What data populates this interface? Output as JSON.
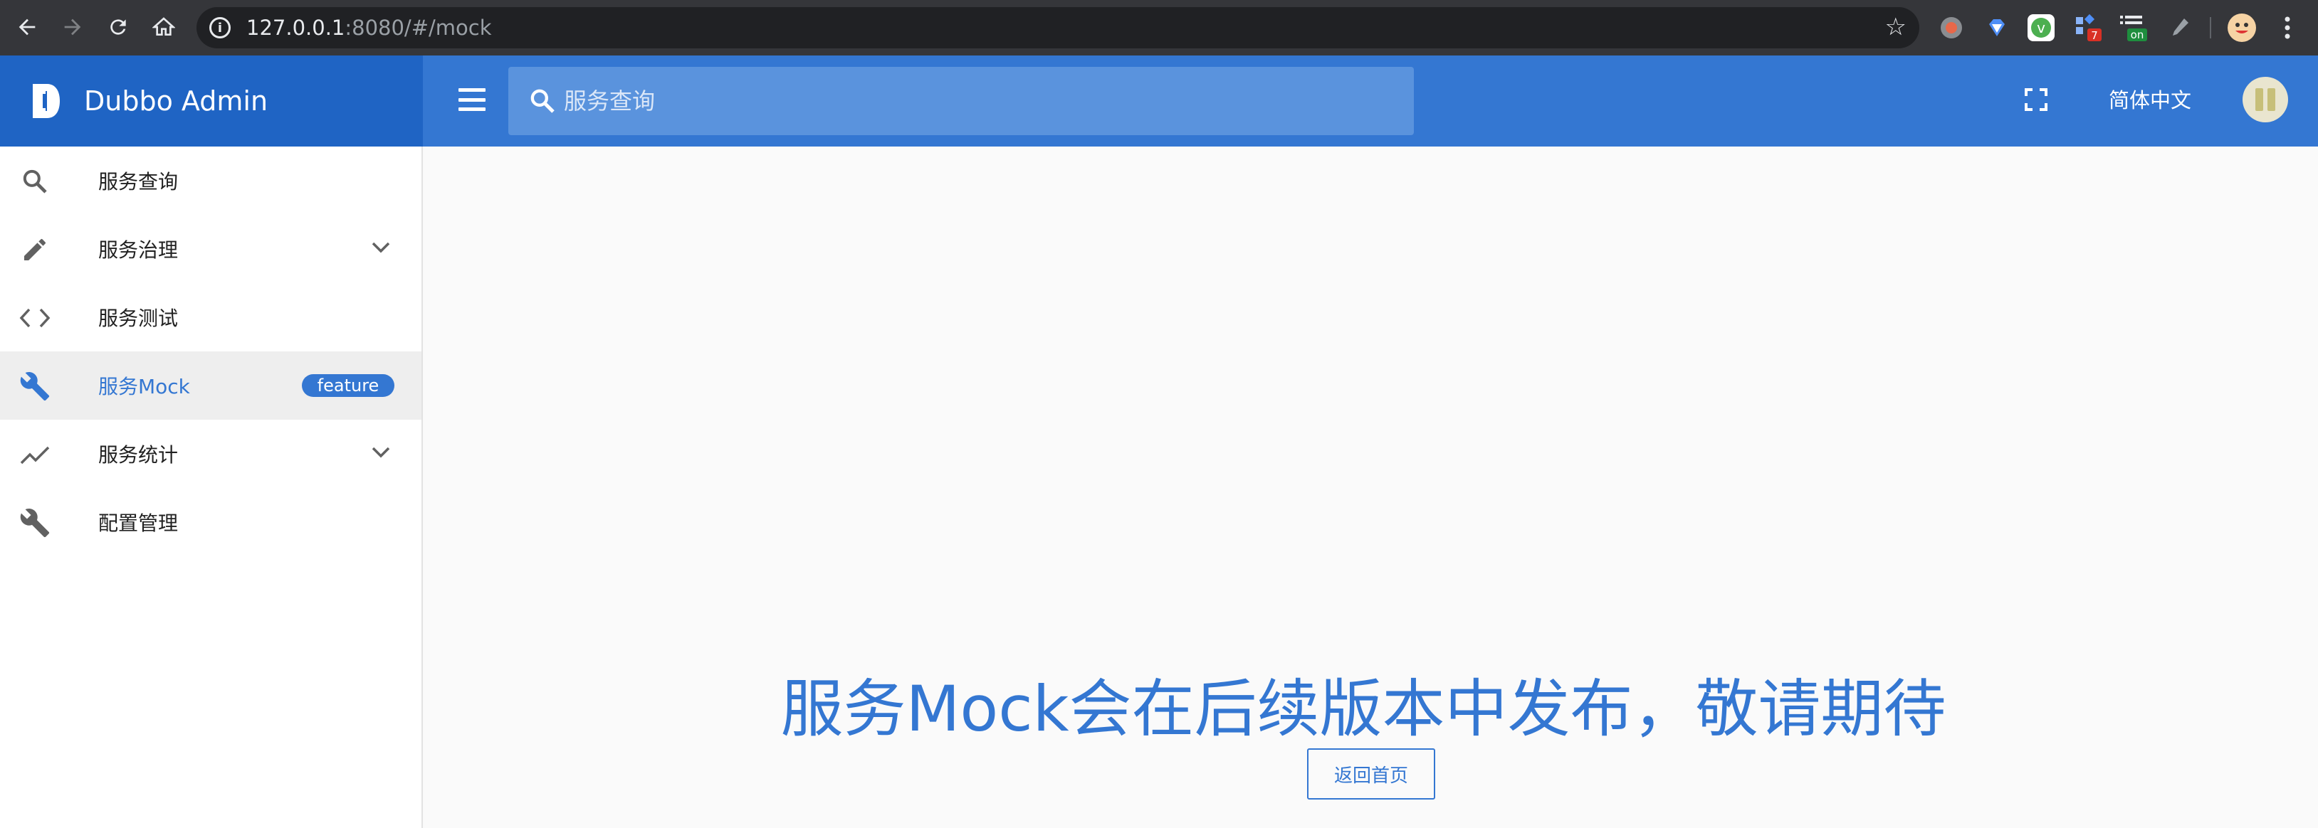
{
  "browser": {
    "url_host": "127.0.0.1",
    "url_rest": ":8080/#/mock",
    "ext_badge_red": "7",
    "ext_badge_green": "on"
  },
  "app": {
    "title": "Dubbo Admin",
    "search_placeholder": "服务查询",
    "language": "简体中文"
  },
  "sidebar": {
    "items": [
      {
        "label": "服务查询",
        "icon": "search-icon"
      },
      {
        "label": "服务治理",
        "icon": "pencil-icon",
        "expandable": true
      },
      {
        "label": "服务测试",
        "icon": "code-icon"
      },
      {
        "label": "服务Mock",
        "icon": "wrench-icon",
        "active": true,
        "badge": "feature"
      },
      {
        "label": "服务统计",
        "icon": "trend-icon",
        "expandable": true
      },
      {
        "label": "配置管理",
        "icon": "wrench-icon"
      }
    ]
  },
  "main": {
    "message": "服务Mock会在后续版本中发布，敬请期待",
    "home_button": "返回首页"
  },
  "colors": {
    "primary": "#3477d2",
    "brand_dark": "#1f64c4"
  }
}
